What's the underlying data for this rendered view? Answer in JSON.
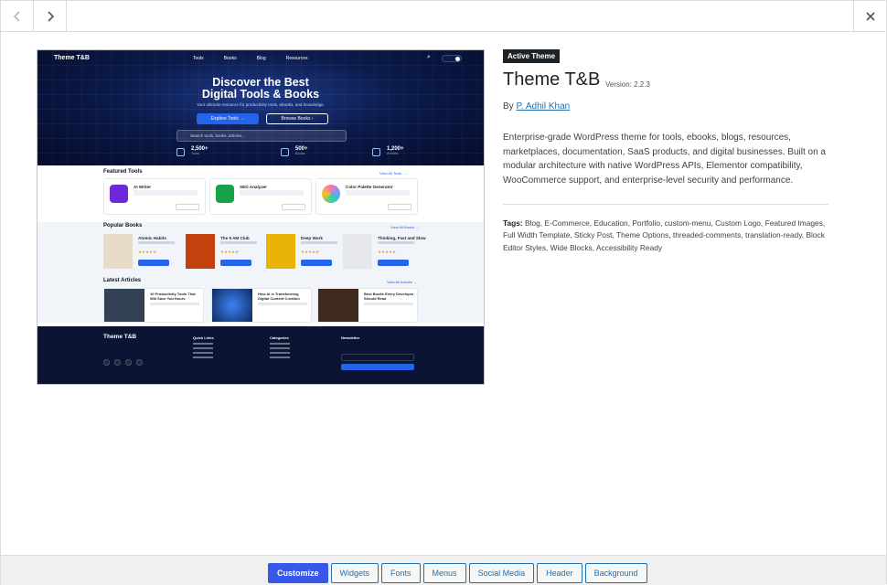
{
  "nav": {
    "prev_icon": "chevron-left-icon",
    "next_icon": "chevron-right-icon",
    "close_icon": "close-icon"
  },
  "preview": {
    "brand": "Theme T&B",
    "menu": [
      "Tools",
      "Books",
      "Blog",
      "Resources"
    ],
    "hero_title_1": "Discover the Best",
    "hero_title_2": "Digital Tools & Books",
    "hero_sub": "Your ultimate resource for productivity tools, ebooks, and knowledge.",
    "btn_explore": "Explore Tools →",
    "btn_browse": "Browse Books ›",
    "search_placeholder": "Search tools, books, articles...",
    "stats": [
      {
        "value": "2,500+",
        "label": "Tools"
      },
      {
        "value": "500+",
        "label": "Books"
      },
      {
        "value": "1,200+",
        "label": "Articles"
      }
    ],
    "featured_title": "Featured Tools",
    "view_all_tools": "View All Tools →",
    "tools": [
      {
        "name": "AI Writer",
        "color": "#6d28d9"
      },
      {
        "name": "SEO Analyzer",
        "color": "#16a34a"
      },
      {
        "name": "Color Palette Generator",
        "color": "#f472b6"
      }
    ],
    "books_title": "Popular Books",
    "view_all_books": "View All Books →",
    "books": [
      {
        "name": "Atomic Habits",
        "color": "#e8dcc8",
        "stars": "★★★★★"
      },
      {
        "name": "The 5 AM Club",
        "color": "#c2410c",
        "stars": "★★★★★"
      },
      {
        "name": "Deep Work",
        "color": "#eab308",
        "stars": "★★★★★"
      },
      {
        "name": "Thinking, Fast and Slow",
        "color": "#e5e7eb",
        "stars": "★★★★★"
      }
    ],
    "articles_title": "Latest Articles",
    "view_all_articles": "View All Articles →",
    "articles": [
      {
        "name": "10 Productivity Tools That Will Save You Hours",
        "color": "#334155"
      },
      {
        "name": "How AI is Transforming Digital Content Creation",
        "color": "#0f2a5a"
      },
      {
        "name": "Best Books Every Developer Should Read",
        "color": "#3f2a1e"
      }
    ],
    "footer_brand": "Theme T&B",
    "footer_cols": [
      "Quick Links",
      "Categories",
      "Newsletter"
    ],
    "subscribe": "Subscribe"
  },
  "info": {
    "badge": "Active Theme",
    "name": "Theme T&B",
    "version": "Version: 2.2.3",
    "by": "By",
    "author": "P. Adhil Khan",
    "description": "Enterprise-grade WordPress theme for tools, ebooks, blogs, resources, marketplaces, documentation, SaaS products, and digital businesses. Built on a modular architecture with native WordPress APIs, Elementor compatibility, WooCommerce support, and enterprise-level security and performance.",
    "tags_label": "Tags:",
    "tags": "Blog, E-Commerce, Education, Portfolio, custom-menu, Custom Logo, Featured Images, Full Width Template, Sticky Post, Theme Options, threaded-comments, translation-ready, Block Editor Styles, Wide Blocks, Accessibility Ready"
  },
  "toolbar": [
    "Customize",
    "Widgets",
    "Fonts",
    "Menus",
    "Social Media",
    "Header",
    "Background"
  ]
}
